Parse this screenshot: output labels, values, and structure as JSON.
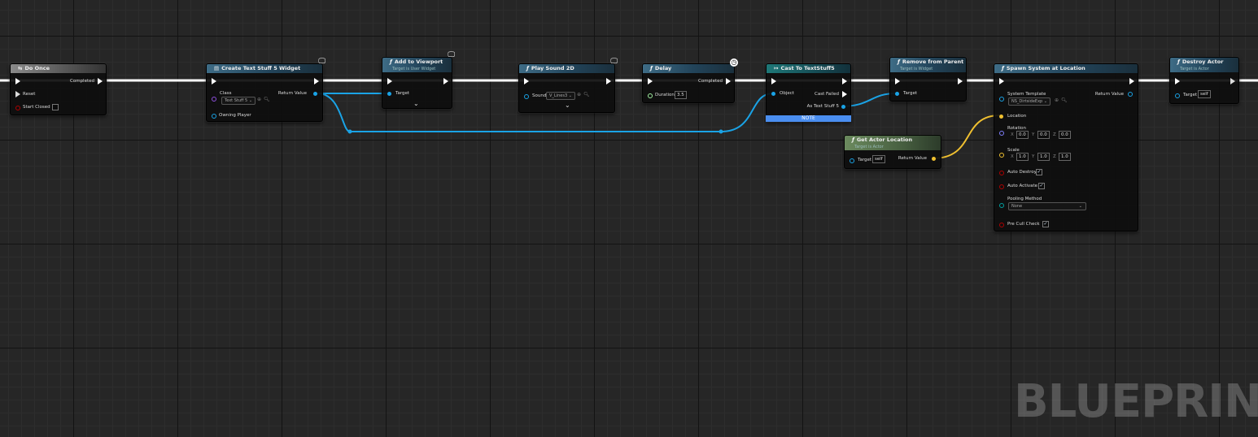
{
  "watermark": "BLUEPRINT",
  "colors": {
    "exec": "#ffffff",
    "object": "#1aa3e6",
    "vector": "#f0c030",
    "float": "#a1f0a1",
    "bool": "#b00000",
    "struct": "#00a0a0",
    "class": "#9050e0"
  },
  "nodes": {
    "do_once": {
      "title": "Do Once",
      "completed": "Completed",
      "reset": "Reset",
      "start_closed": "Start Closed"
    },
    "create_widget": {
      "title": "Create Text Stuff 5 Widget",
      "class_label": "Class",
      "class_value": "Text Stuff 5",
      "return_value": "Return Value",
      "owning_player": "Owning Player"
    },
    "add_viewport": {
      "title": "Add to Viewport",
      "subtitle": "Target is User Widget",
      "target": "Target"
    },
    "play_sound": {
      "title": "Play Sound 2D",
      "sound_label": "Sound",
      "sound_value": "V_Lines3"
    },
    "delay": {
      "title": "Delay",
      "completed": "Completed",
      "duration_label": "Duration",
      "duration_value": "3.5"
    },
    "cast": {
      "title": "Cast To TextStuff5",
      "object": "Object",
      "cast_failed": "Cast Failed",
      "as_text": "As Text Stuff 5",
      "note": "NOTE"
    },
    "remove_parent": {
      "title": "Remove from Parent",
      "subtitle": "Target is Widget",
      "target": "Target"
    },
    "get_actor_location": {
      "title": "Get Actor Location",
      "subtitle": "Target is Actor",
      "target": "Target",
      "target_value": "self",
      "return_value": "Return Value"
    },
    "spawn_system": {
      "title": "Spawn System at Location",
      "system_template": "System Template",
      "template_value": "NS_DirtsideExp",
      "return_value": "Return Value",
      "location": "Location",
      "rotation": "Rotation",
      "rot_x": "0.0",
      "rot_y": "0.0",
      "rot_z": "0.0",
      "scale": "Scale",
      "scale_x": "1.0",
      "scale_y": "1.0",
      "scale_z": "1.0",
      "x": "X",
      "y": "Y",
      "z": "Z",
      "auto_destroy": "Auto Destroy",
      "auto_activate": "Auto Activate",
      "pooling_method": "Pooling Method",
      "pooling_value": "None",
      "pre_cull": "Pre Cull Check"
    },
    "destroy_actor": {
      "title": "Destroy Actor",
      "subtitle": "Target is Actor",
      "target": "Target",
      "target_value": "self"
    }
  }
}
